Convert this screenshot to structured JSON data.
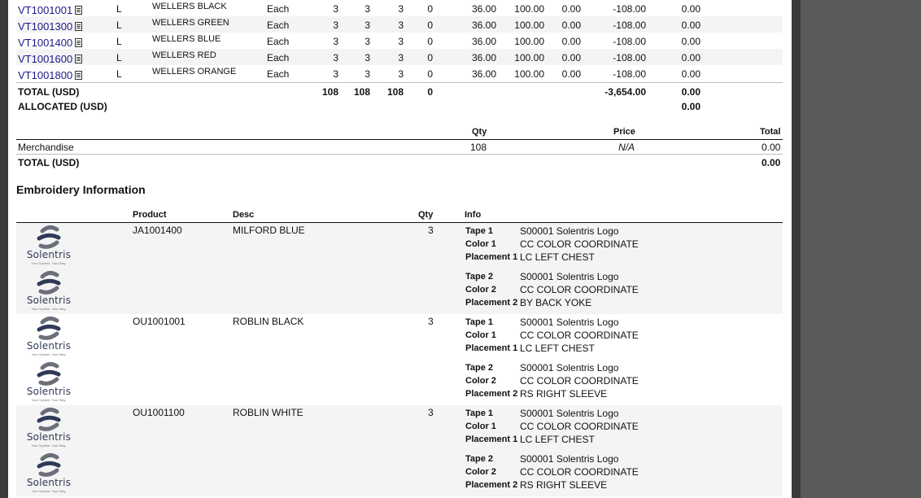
{
  "line_items": [
    {
      "sku": "VT1001001",
      "size": "L",
      "name": "WELLERS BLACK",
      "uom": "Each",
      "q1": "3",
      "q2": "3",
      "q3": "3",
      "q4": "0",
      "p1": "36.00",
      "p2": "100.00",
      "p3": "0.00",
      "p4": "-108.00",
      "p5": "0.00"
    },
    {
      "sku": "VT1001300",
      "size": "L",
      "name": "WELLERS GREEN",
      "uom": "Each",
      "q1": "3",
      "q2": "3",
      "q3": "3",
      "q4": "0",
      "p1": "36.00",
      "p2": "100.00",
      "p3": "0.00",
      "p4": "-108.00",
      "p5": "0.00"
    },
    {
      "sku": "VT1001400",
      "size": "L",
      "name": "WELLERS BLUE",
      "uom": "Each",
      "q1": "3",
      "q2": "3",
      "q3": "3",
      "q4": "0",
      "p1": "36.00",
      "p2": "100.00",
      "p3": "0.00",
      "p4": "-108.00",
      "p5": "0.00"
    },
    {
      "sku": "VT1001600",
      "size": "L",
      "name": "WELLERS RED",
      "uom": "Each",
      "q1": "3",
      "q2": "3",
      "q3": "3",
      "q4": "0",
      "p1": "36.00",
      "p2": "100.00",
      "p3": "0.00",
      "p4": "-108.00",
      "p5": "0.00"
    },
    {
      "sku": "VT1001800",
      "size": "L",
      "name": "WELLERS ORANGE",
      "uom": "Each",
      "q1": "3",
      "q2": "3",
      "q3": "3",
      "q4": "0",
      "p1": "36.00",
      "p2": "100.00",
      "p3": "0.00",
      "p4": "-108.00",
      "p5": "0.00"
    }
  ],
  "totals": {
    "total_label": "TOTAL (USD)",
    "q1": "108",
    "q2": "108",
    "q3": "108",
    "q4": "0",
    "amount": "-3,654.00",
    "last": "0.00",
    "allocated_label": "ALLOCATED (USD)",
    "allocated_value": "0.00"
  },
  "summary": {
    "headers": {
      "qty": "Qty",
      "price": "Price",
      "total": "Total"
    },
    "row": {
      "label": "Merchandise",
      "qty": "108",
      "price": "N/A",
      "total": "0.00"
    },
    "total_label": "TOTAL (USD)",
    "total_value": "0.00"
  },
  "embroidery": {
    "title": "Embroidery Information",
    "headers": {
      "product": "Product",
      "desc": "Desc",
      "qty": "Qty",
      "info": "Info"
    },
    "logo": {
      "name": "Solentris",
      "tagline": "Your System. Your Way."
    },
    "items": [
      {
        "product": "JA1001400",
        "desc": "MILFORD BLUE",
        "qty": "3",
        "tape1_label": "Tape 1",
        "tape1": "S00001 Solentris Logo",
        "color1_label": "Color 1",
        "color1": "CC COLOR COORDINATE",
        "placement1_label": "Placement 1",
        "placement1": "LC LEFT CHEST",
        "tape2_label": "Tape 2",
        "tape2": "S00001 Solentris Logo",
        "color2_label": "Color 2",
        "color2": "CC COLOR COORDINATE",
        "placement2_label": "Placement 2",
        "placement2": "BY BACK YOKE"
      },
      {
        "product": "OU1001001",
        "desc": "ROBLIN BLACK",
        "qty": "3",
        "tape1_label": "Tape 1",
        "tape1": "S00001 Solentris Logo",
        "color1_label": "Color 1",
        "color1": "CC COLOR COORDINATE",
        "placement1_label": "Placement 1",
        "placement1": "LC LEFT CHEST",
        "tape2_label": "Tape 2",
        "tape2": "S00001 Solentris Logo",
        "color2_label": "Color 2",
        "color2": "CC COLOR COORDINATE",
        "placement2_label": "Placement 2",
        "placement2": "RS RIGHT SLEEVE"
      },
      {
        "product": "OU1001100",
        "desc": "ROBLIN WHITE",
        "qty": "3",
        "tape1_label": "Tape 1",
        "tape1": "S00001 Solentris Logo",
        "color1_label": "Color 1",
        "color1": "CC COLOR COORDINATE",
        "placement1_label": "Placement 1",
        "placement1": "LC LEFT CHEST",
        "tape2_label": "Tape 2",
        "tape2": "S00001 Solentris Logo",
        "color2_label": "Color 2",
        "color2": "CC COLOR COORDINATE",
        "placement2_label": "Placement 2",
        "placement2": "RS RIGHT SLEEVE"
      }
    ]
  },
  "colors": {
    "link": "#1a1a8c",
    "frame": "#3a3a3a",
    "alt_row": "#f4f4f4"
  }
}
